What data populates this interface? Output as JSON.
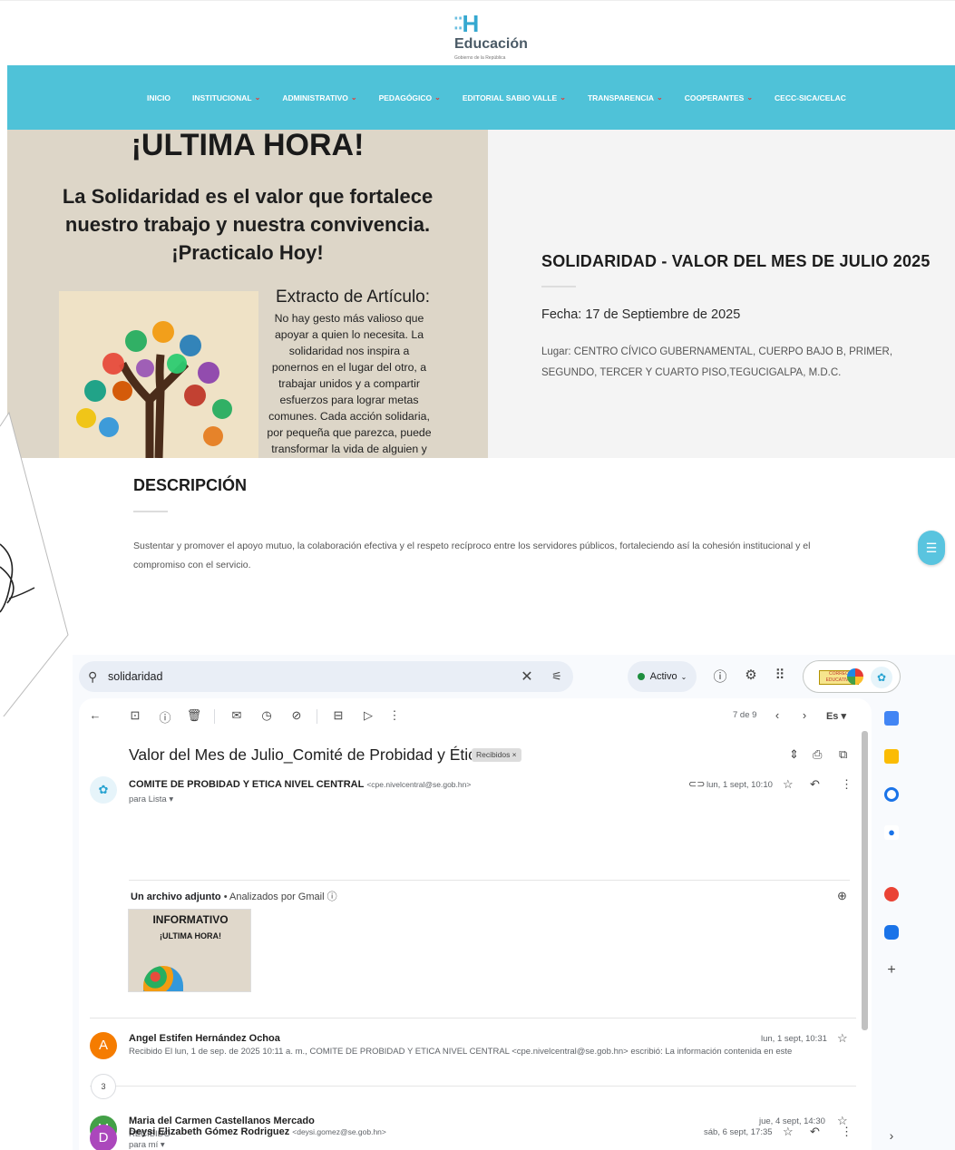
{
  "site": {
    "logo_mark": "H",
    "logo_name": "Educación",
    "logo_sub": "Gobierno de la República",
    "nav": [
      {
        "label": "INICIO",
        "caret": false
      },
      {
        "label": "INSTITUCIONAL",
        "caret": true
      },
      {
        "label": "ADMINISTRATIVO",
        "caret": true
      },
      {
        "label": "PEDAGÓGICO",
        "caret": true
      },
      {
        "label": "EDITORIAL SABIO VALLE",
        "caret": true
      },
      {
        "label": "TRANSPARENCIA",
        "caret": true
      },
      {
        "label": "COOPERANTES",
        "caret": true
      },
      {
        "label": "CECC-SICA/CELAC",
        "caret": false
      }
    ],
    "poster": {
      "top": "¡ULTIMA HORA!",
      "headline": "La Solidaridad es el valor que fortalece nuestro trabajo y nuestra convivencia. ¡Practicalo Hoy!",
      "extract_title": "Extracto de Artículo:",
      "extract_body": "No hay gesto más valioso que apoyar a quien lo necesita. La solidaridad nos inspira a ponernos en el lugar del otro, a trabajar unidos y a compartir esfuerzos para lograr metas comunes. Cada acción solidaria, por pequeña que parezca, puede transformar la vida de alguien y"
    },
    "event": {
      "title": "SOLIDARIDAD - VALOR DEL MES DE JULIO 2025",
      "date": "Fecha: 17 de Septiembre de 2025",
      "place": "Lugar: CENTRO CÍVICO GUBERNAMENTAL, CUERPO BAJO B, PRIMER, SEGUNDO, TERCER Y CUARTO PISO,TEGUCIGALPA, M.D.C."
    },
    "description": {
      "heading": "DESCRIPCIÓN",
      "body": "Sustentar y promover el apoyo mutuo, la colaboración efectiva y el respeto recíproco entre los servidores públicos, fortaleciendo así la cohesión institucional y el compromiso con el servicio."
    }
  },
  "gmail": {
    "search_value": "solidaridad",
    "status": "Activo",
    "account_logo_text": "CORREO EDUCATIVO",
    "toolbar_count": "7 de 9",
    "language": "Es",
    "subject": "Valor del Mes de Julio_Comité de Probidad y Ética",
    "label": "Recibidos ×",
    "first_message": {
      "sender": "COMITE DE PROBIDAD Y ETICA NIVEL CENTRAL",
      "email": "<cpe.nivelcentral@se.gob.hn>",
      "to": "para Lista ▾",
      "date": "lun, 1 sept, 10:10"
    },
    "attachment": {
      "head": "Un archivo adjunto",
      "scanned": "• Analizados por Gmail ⓘ",
      "thumb_title": "INFORMATIVO",
      "thumb_sub": "¡ULTIMA HORA!"
    },
    "messages": [
      {
        "initial": "A",
        "color": "#f57c00",
        "sender": "Angel Estifen Hernández Ochoa",
        "date": "lun, 1 sept, 10:31",
        "snippet": "Recibido El lun, 1 de sep. de 2025 10:11 a. m., COMITE DE PROBIDAD Y ETICA NIVEL CENTRAL <cpe.nivelcentral@se.gob.hn> escribió: La información contenida en este"
      },
      {
        "initial": "M",
        "color": "#43a047",
        "sender": "Maria del Carmen Castellanos Mercado",
        "date": "jue, 4 sept, 14:30",
        "snippet": "RECIBIDO"
      },
      {
        "initial": "D",
        "color": "#ab47bc",
        "sender": "Deysi Elizabeth Gómez Rodriguez",
        "email": "<deysi.gomez@se.gob.hn>",
        "date": "sáb, 6 sept, 17:35",
        "snippet": "para mí ▾"
      }
    ],
    "collapsed_count": "3"
  }
}
